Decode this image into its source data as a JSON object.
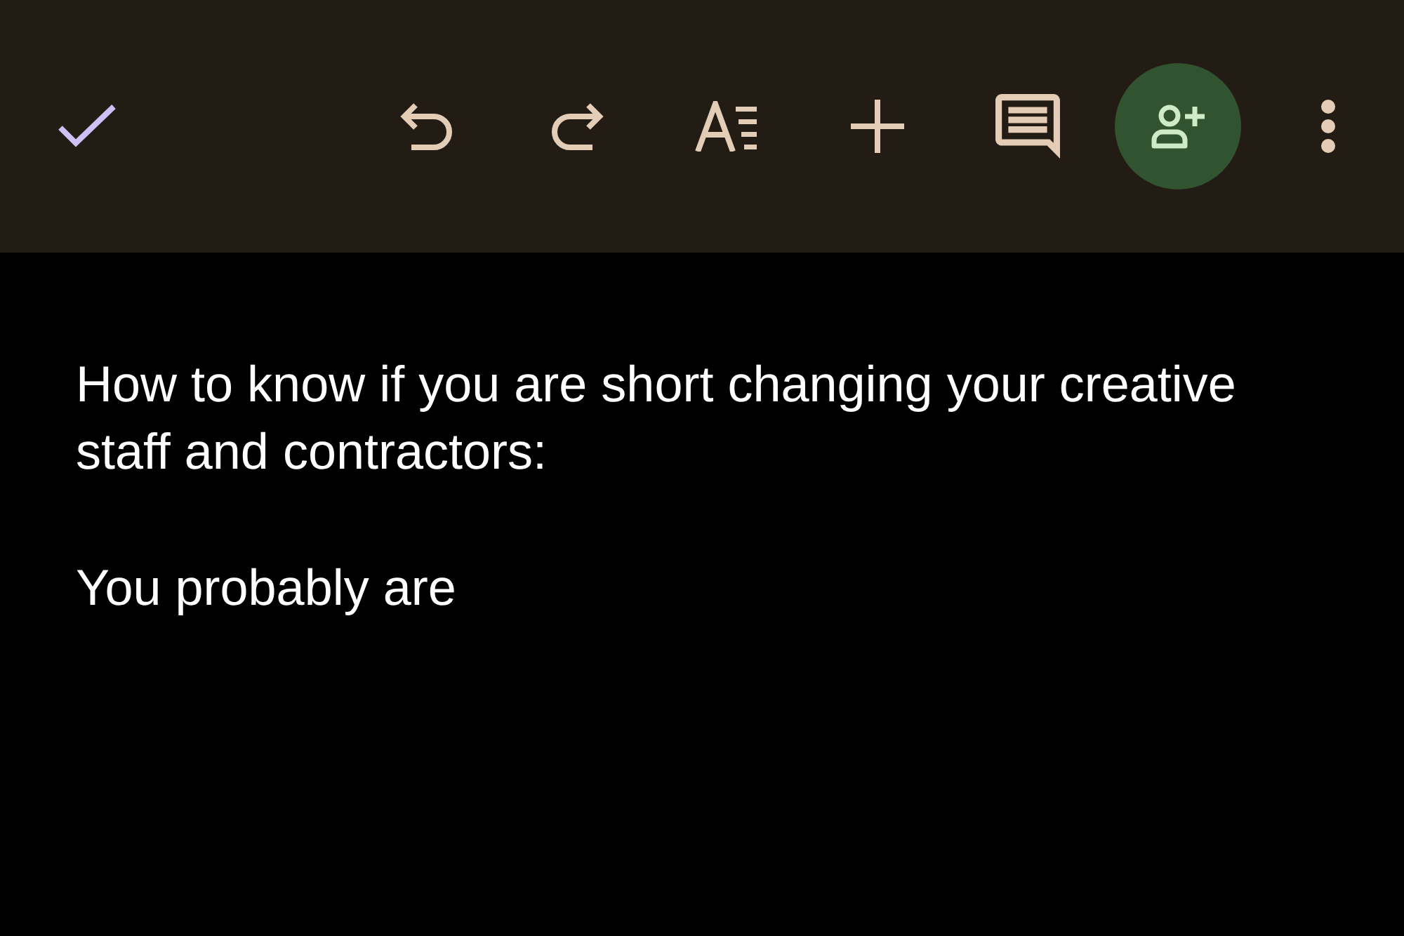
{
  "document": {
    "paragraphs": [
      "How to know if you are short changing your creative staff and contractors:",
      "You probably are"
    ]
  }
}
